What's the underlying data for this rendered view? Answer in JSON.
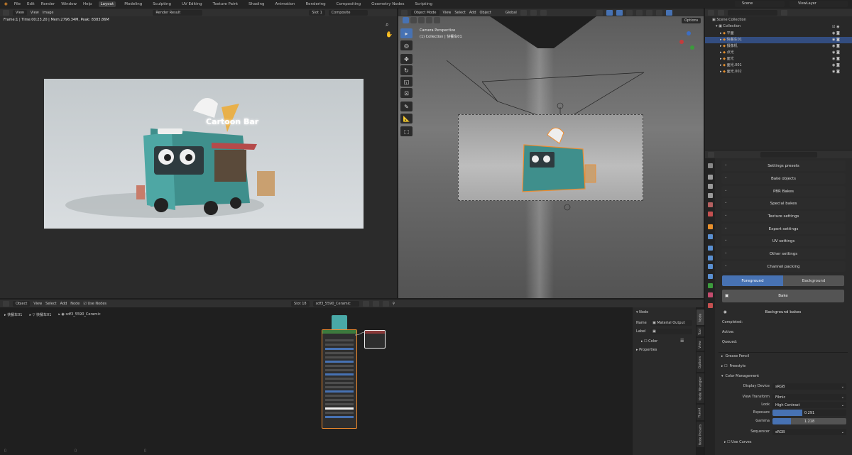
{
  "menu": [
    "File",
    "Edit",
    "Render",
    "Window",
    "Help"
  ],
  "workspaces": [
    "Layout",
    "Modeling",
    "Sculpting",
    "UV Editing",
    "Texture Paint",
    "Shading",
    "Animation",
    "Rendering",
    "Compositing",
    "Geometry Nodes",
    "Scripting"
  ],
  "scene": {
    "name": "Scene",
    "view_layer": "ViewLayer"
  },
  "image_editor": {
    "header": {
      "view": "View",
      "image": "Image",
      "image_name": "Render Result",
      "slot": "Slot 1",
      "composite": "Composite"
    },
    "info": "Frame:1 | Time:00:23.20 | Mem:2796.34M, Peak: 8383.86M",
    "sign": "Cartoon Bar"
  },
  "viewport": {
    "header": {
      "mode": "Object Mode",
      "view": "View",
      "select": "Select",
      "add": "Add",
      "object": "Object",
      "transform": "Global"
    },
    "options": "Options",
    "overlay_title": "Camera Perspective",
    "overlay_sub": "(1) Collection | 快餐车01"
  },
  "outliner": {
    "root": "Scene Collection",
    "collection": "Collection",
    "items": [
      "平面",
      "快餐车01",
      "摄像机",
      "点光",
      "面光",
      "面光.001",
      "面光.002"
    ]
  },
  "node_editor": {
    "header": {
      "object": "Object",
      "view": "View",
      "select": "Select",
      "add": "Add",
      "node": "Node",
      "use_nodes": "Use Nodes",
      "slot": "Slot 18",
      "material": "sdf3_5590_Ceramic"
    },
    "breadcrumb": [
      "快餐车01",
      "快餐车01",
      "sdf3_5590_Ceramic"
    ],
    "panel": {
      "title": "Node",
      "name_label": "Name",
      "name_value": "Material Output",
      "label_label": "Label",
      "color": "Color",
      "properties": "Properties"
    },
    "tabs": [
      "Node",
      "Tool",
      "View",
      "Options",
      "Node Wrangler",
      "Fluent",
      "Node Presets"
    ]
  },
  "properties": {
    "bake_sections": [
      "Settings presets",
      "Bake objects",
      "PBR Bakes",
      "Special bakes",
      "Texture settings",
      "Export settings",
      "UV settings",
      "Other settings",
      "Channel packing"
    ],
    "foreground": "Foreground",
    "background": "Background",
    "bake": "Bake",
    "background_bakes": "Background bakes",
    "completed": "Completed:",
    "active": "Active:",
    "queued": "Queued:",
    "grease_pencil": "Grease Pencil",
    "freestyle": "Freestyle",
    "color_management": "Color Management",
    "display_device_label": "Display Device",
    "display_device": "sRGB",
    "view_transform_label": "View Transform",
    "view_transform": "Filmic",
    "look_label": "Look",
    "look": "High Contrast",
    "exposure_label": "Exposure",
    "exposure": "0.291",
    "exposure_fraction": 0.4,
    "gamma_label": "Gamma",
    "gamma": "1.218",
    "gamma_fraction": 0.25,
    "sequencer_label": "Sequencer",
    "sequencer": "sRGB",
    "use_curves": "Use Curves"
  },
  "colors": {
    "accent": "#4772b3",
    "selection": "#ef8b2d",
    "background": "#1d1d1d",
    "header": "#303030",
    "teal": "#49a9a7"
  }
}
